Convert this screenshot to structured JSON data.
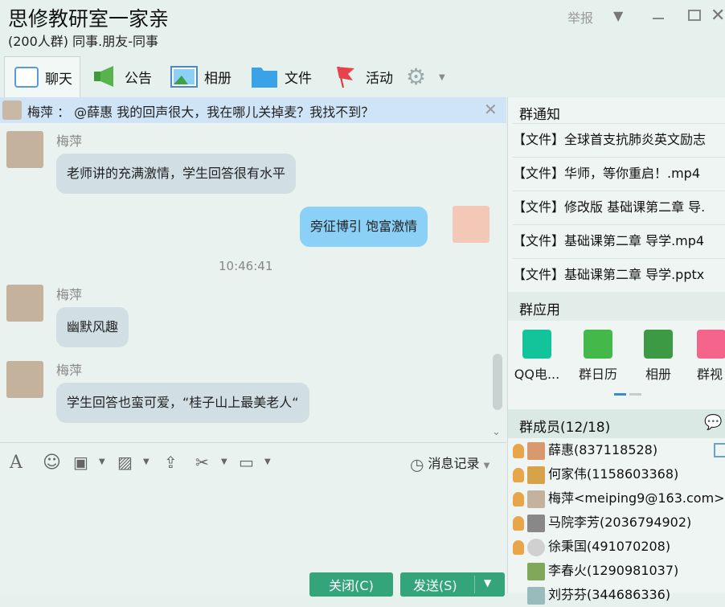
{
  "window": {
    "title": "思修教研室一家亲",
    "subtitle": "(200人群) 同事.朋友-同事",
    "report": "举报"
  },
  "tabs": [
    {
      "label": "聊天",
      "icon": "chat-icon"
    },
    {
      "label": "公告",
      "icon": "megaphone-icon"
    },
    {
      "label": "相册",
      "icon": "photo-icon"
    },
    {
      "label": "文件",
      "icon": "folder-icon"
    },
    {
      "label": "活动",
      "icon": "flag-icon"
    }
  ],
  "at_bar": {
    "text": "梅萍 ：  @薛惠 我的回声很大，我在哪儿关掉麦？我找不到？"
  },
  "messages": [
    {
      "sender": "梅萍",
      "text": "老师讲的充满激情，学生回答很有水平"
    },
    {
      "sender": "",
      "text": "旁征博引 饱富激情"
    },
    {
      "time": "10:46:41"
    },
    {
      "sender": "梅萍",
      "text": "幽默风趣"
    },
    {
      "sender": "梅萍",
      "text": "学生回答也蛮可爱，“桂子山上最美老人“"
    }
  ],
  "toolbar": {
    "history": "消息记录"
  },
  "buttons": {
    "close": "关闭(C)",
    "send": "发送(S)"
  },
  "notice_section": {
    "title": "群通知",
    "items": [
      "【文件】全球首支抗肺炎英文励志",
      "【文件】华师，等你重启！.mp4",
      "【文件】修改版 基础课第二章 导.",
      "【文件】基础课第二章 导学.mp4",
      "【文件】基础课第二章 导学.pptx"
    ]
  },
  "apps_section": {
    "title": "群应用",
    "apps": [
      {
        "label": "QQ电...",
        "color": "#13c49b"
      },
      {
        "label": "群日历",
        "color": "#45b84a"
      },
      {
        "label": "相册",
        "color": "#3c9a45"
      },
      {
        "label": "群视",
        "color": "#f5648a"
      }
    ]
  },
  "members_section": {
    "title": "群成员(12/18)",
    "members": [
      "薛惠(837118528)",
      "何家伟(1158603368)",
      "梅萍<meiping9@163.com>",
      "马院李芳(2036794902)",
      "徐秉国(491070208)",
      "李春火(1290981037)",
      "刘芬芬(344686336)"
    ]
  },
  "colors": {
    "accent_green": "#34a57a",
    "my_bubble": "#8ad0f7",
    "other_bubble": "#d1dfe4",
    "at_bar": "#cfe4f7"
  }
}
